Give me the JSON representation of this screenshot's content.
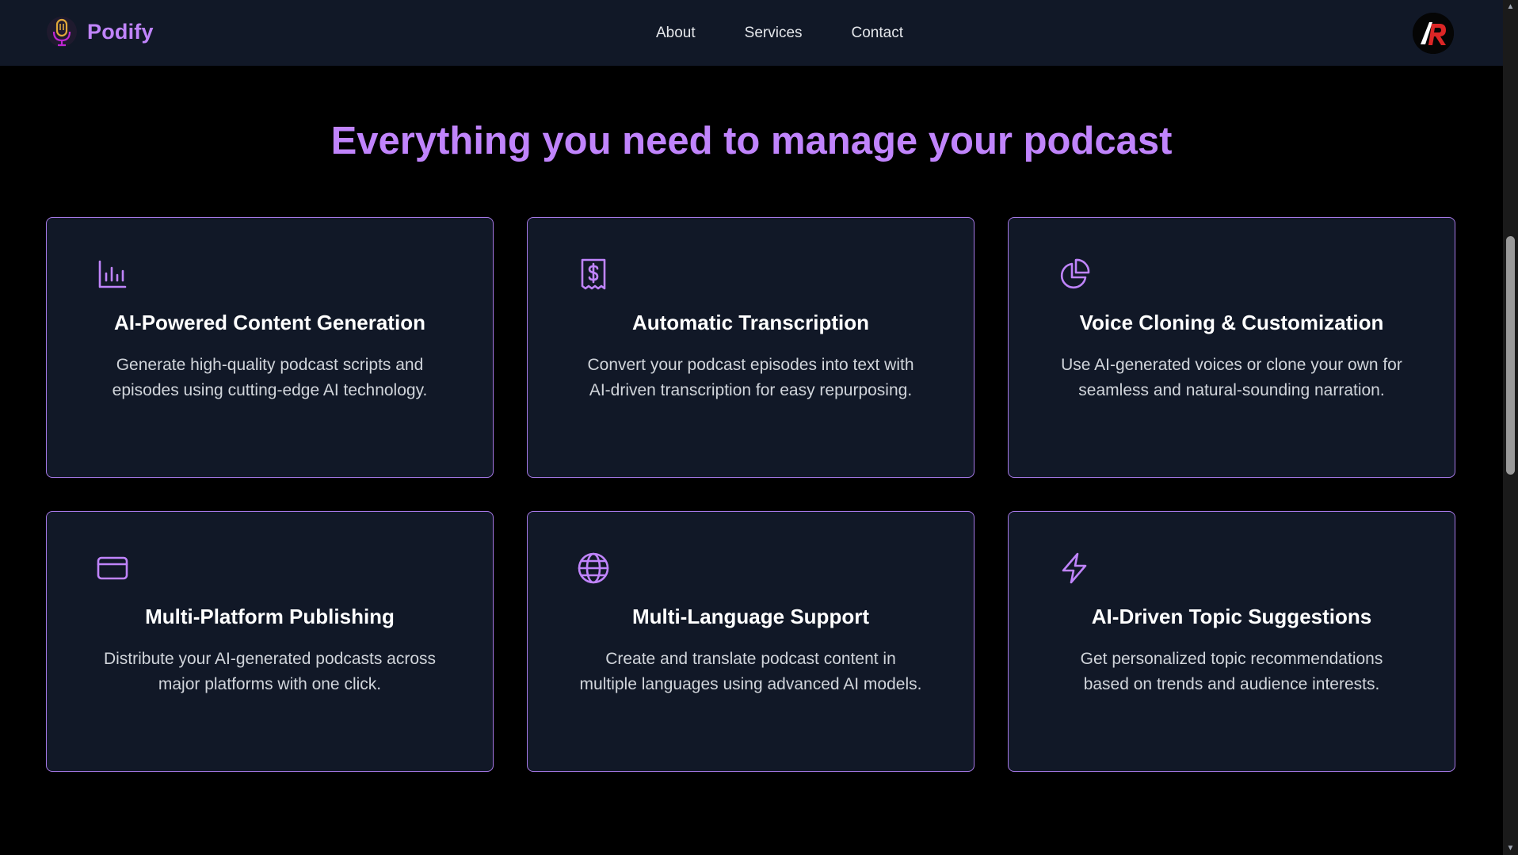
{
  "brand": {
    "name": "Podify",
    "accent_color": "#c084fc",
    "logo_icon": "microphone-icon"
  },
  "nav": {
    "items": [
      {
        "label": "About"
      },
      {
        "label": "Services"
      },
      {
        "label": "Contact"
      }
    ]
  },
  "user": {
    "avatar_icon": "user-avatar-ar-logo"
  },
  "main": {
    "title": "Everything you need to manage your podcast",
    "features": [
      {
        "icon": "bar-chart-icon",
        "title": "AI-Powered Content Generation",
        "description": "Generate high-quality podcast scripts and episodes using cutting-edge AI technology."
      },
      {
        "icon": "receipt-dollar-icon",
        "title": "Automatic Transcription",
        "description": "Convert your podcast episodes into text with AI-driven transcription for easy repurposing."
      },
      {
        "icon": "pie-chart-icon",
        "title": "Voice Cloning & Customization",
        "description": "Use AI-generated voices or clone your own for seamless and natural-sounding narration."
      },
      {
        "icon": "credit-card-icon",
        "title": "Multi-Platform Publishing",
        "description": "Distribute your AI-generated podcasts across major platforms with one click."
      },
      {
        "icon": "globe-icon",
        "title": "Multi-Language Support",
        "description": "Create and translate podcast content in multiple languages using advanced AI models."
      },
      {
        "icon": "lightning-bolt-icon",
        "title": "AI-Driven Topic Suggestions",
        "description": "Get personalized topic recommendations based on trends and audience interests."
      }
    ]
  },
  "colors": {
    "background": "#000000",
    "surface": "#111827",
    "card_border": "#a578e6",
    "heading": "#c084fc",
    "text": "#d1d5db"
  }
}
